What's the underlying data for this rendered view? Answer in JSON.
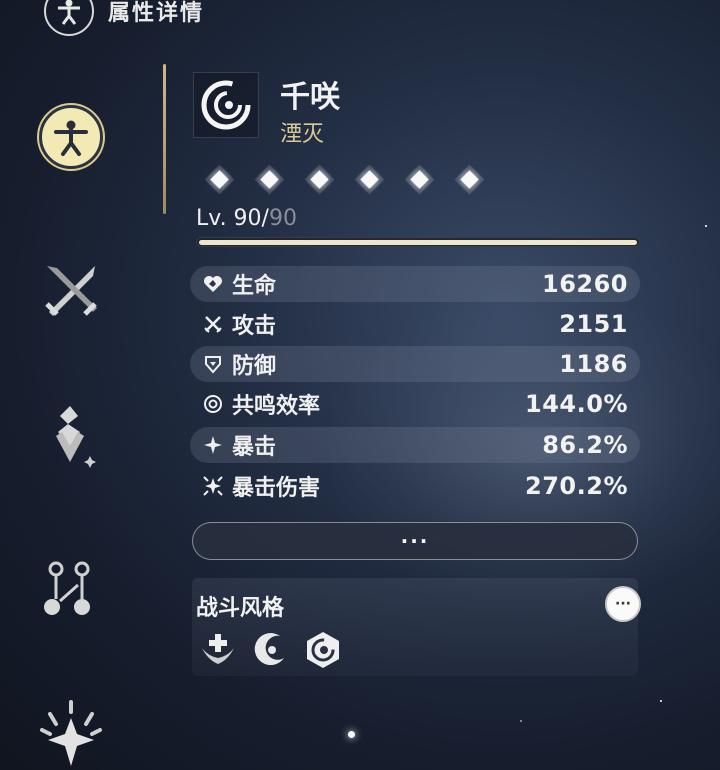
{
  "header": {
    "title": "属性详情",
    "icon": "vitruvian-icon"
  },
  "nav": {
    "items": [
      {
        "icon": "vitruvian-icon",
        "active": true
      },
      {
        "icon": "crossed-swords-icon",
        "active": false
      },
      {
        "icon": "echo-icon",
        "active": false
      },
      {
        "icon": "skill-tree-icon",
        "active": false
      },
      {
        "icon": "resonance-chain-icon",
        "active": false
      }
    ]
  },
  "character": {
    "name": "千咲",
    "element": "湮灭",
    "element_icon": "havoc-swirl-icon",
    "sequence_nodes": 6,
    "level_current": "Lv. 90/",
    "level_max": "90",
    "level_progress": 1.0
  },
  "stats": [
    {
      "label": "生命",
      "value": "16260",
      "icon": "heart-icon"
    },
    {
      "label": "攻击",
      "value": "2151",
      "icon": "attack-swords-icon"
    },
    {
      "label": "防御",
      "value": "1186",
      "icon": "shield-icon"
    },
    {
      "label": "共鸣效率",
      "value": "144.0%",
      "icon": "energy-regen-icon"
    },
    {
      "label": "暴击",
      "value": "86.2%",
      "icon": "crit-star-icon"
    },
    {
      "label": "暴击伤害",
      "value": "270.2%",
      "icon": "crit-damage-icon"
    }
  ],
  "more_button": {
    "label": "···"
  },
  "combat_style": {
    "title": "战斗风格",
    "more_label": "···",
    "icons": [
      "healing-wings-icon",
      "crescent-swirl-icon",
      "havoc-hex-icon"
    ]
  },
  "colors": {
    "accent_gold": "#d9c996",
    "active_nav": "#f3e9b5",
    "panel_band": "#5a6478"
  }
}
